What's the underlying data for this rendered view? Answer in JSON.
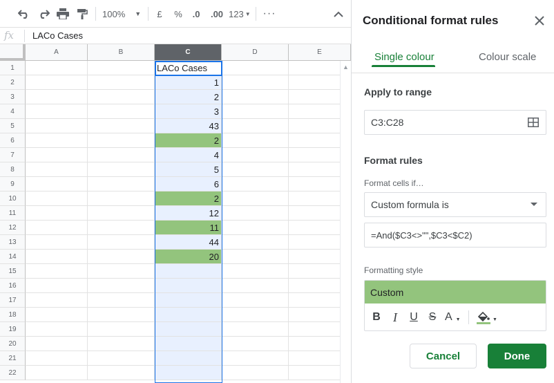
{
  "toolbar": {
    "zoom": "100%",
    "currency": "£",
    "percent": "%",
    "decrease_decimals": ".0",
    "increase_decimals": ".00",
    "more_formats": "123"
  },
  "formula_bar": {
    "fx_label": "fx",
    "value": "LACo Cases"
  },
  "grid": {
    "columns": [
      "A",
      "B",
      "C",
      "D",
      "E"
    ],
    "selected_column": "C",
    "rows": [
      {
        "num": "1",
        "c": "LACo Cases",
        "highlight": false
      },
      {
        "num": "2",
        "c": "1",
        "highlight": false
      },
      {
        "num": "3",
        "c": "2",
        "highlight": false
      },
      {
        "num": "4",
        "c": "3",
        "highlight": false
      },
      {
        "num": "5",
        "c": "43",
        "highlight": false
      },
      {
        "num": "6",
        "c": "2",
        "highlight": true
      },
      {
        "num": "7",
        "c": "4",
        "highlight": false
      },
      {
        "num": "8",
        "c": "5",
        "highlight": false
      },
      {
        "num": "9",
        "c": "6",
        "highlight": false
      },
      {
        "num": "10",
        "c": "2",
        "highlight": true
      },
      {
        "num": "11",
        "c": "12",
        "highlight": false
      },
      {
        "num": "12",
        "c": "11",
        "highlight": true
      },
      {
        "num": "13",
        "c": "44",
        "highlight": false
      },
      {
        "num": "14",
        "c": "20",
        "highlight": true
      },
      {
        "num": "15",
        "c": "",
        "highlight": false
      },
      {
        "num": "16",
        "c": "",
        "highlight": false
      },
      {
        "num": "17",
        "c": "",
        "highlight": false
      },
      {
        "num": "18",
        "c": "",
        "highlight": false
      },
      {
        "num": "19",
        "c": "",
        "highlight": false
      },
      {
        "num": "20",
        "c": "",
        "highlight": false
      },
      {
        "num": "21",
        "c": "",
        "highlight": false
      },
      {
        "num": "22",
        "c": "",
        "highlight": false
      }
    ],
    "highlight_color": "#93c47d",
    "selection_color": "#e8f0fe"
  },
  "panel": {
    "title": "Conditional format rules",
    "tabs": [
      {
        "label": "Single colour"
      },
      {
        "label": "Colour scale"
      }
    ],
    "apply_to_range_label": "Apply to range",
    "range_value": "C3:C28",
    "format_rules_label": "Format rules",
    "format_cells_if_label": "Format cells if…",
    "condition_value": "Custom formula is",
    "formula_value": "=And($C3<>\"\",$C3<$C2)",
    "formatting_style_label": "Formatting style",
    "style_preview_text": "Custom",
    "style_fill_color": "#93c47d",
    "style_tools": {
      "bold": "B",
      "italic": "I",
      "underline": "U",
      "strikethrough": "S",
      "text_color": "A"
    },
    "cancel_label": "Cancel",
    "done_label": "Done",
    "accent_color": "#188038"
  }
}
